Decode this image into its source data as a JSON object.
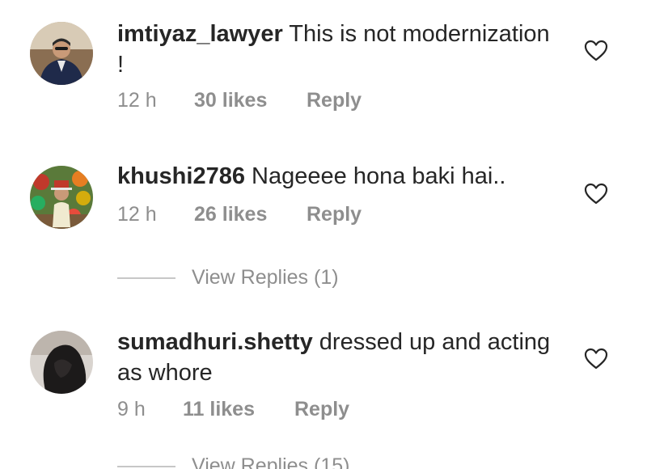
{
  "comments": [
    {
      "username": "imtiyaz_lawyer",
      "text": "This is not modernization !",
      "time": "12 h",
      "likes": "30 likes",
      "reply": "Reply"
    },
    {
      "username": "khushi2786",
      "text": "Nageeee hona baki hai..",
      "time": "12 h",
      "likes": "26 likes",
      "reply": "Reply"
    },
    {
      "username": "sumadhuri.shetty",
      "text": "dressed up and acting as whore",
      "time": "9 h",
      "likes": "11 likes",
      "reply": "Reply"
    }
  ],
  "view_replies": [
    {
      "label": "View Replies (1)"
    },
    {
      "label": "View Replies (15)"
    }
  ],
  "icons": {
    "like": "heart-outline-icon"
  },
  "colors": {
    "text": "#262626",
    "secondary": "#8e8e8e",
    "divider": "#c7c7c7"
  }
}
